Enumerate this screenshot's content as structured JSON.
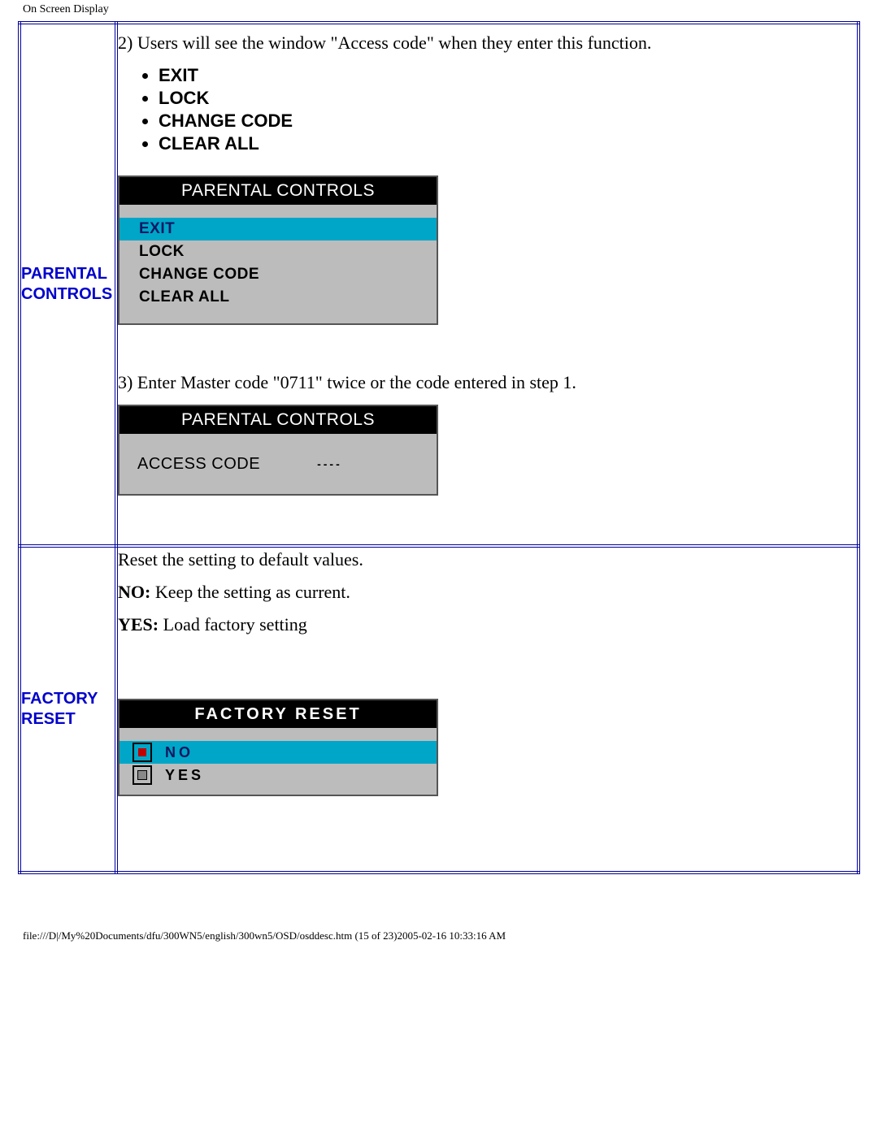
{
  "header": "On Screen Display",
  "rows": [
    {
      "label_line1": "PARENTAL",
      "label_line2": "CONTROLS",
      "step2_text": "2) Users will see the window \"Access code\" when they enter this function.",
      "bullets": [
        "EXIT",
        "LOCK",
        "CHANGE CODE",
        "CLEAR ALL"
      ],
      "osd1": {
        "title": "PARENTAL CONTROLS",
        "items": [
          {
            "label": "EXIT",
            "selected": true
          },
          {
            "label": "LOCK",
            "selected": false
          },
          {
            "label": "CHANGE CODE",
            "selected": false
          },
          {
            "label": "CLEAR ALL",
            "selected": false
          }
        ]
      },
      "step3_text": "3) Enter Master code \"0711\" twice or the code entered in step 1.",
      "osd2": {
        "title": "PARENTAL CONTROLS",
        "access_label": "ACCESS CODE",
        "access_value": "----"
      }
    },
    {
      "label_line1": "FACTORY",
      "label_line2": "RESET",
      "intro": "Reset the setting to default values.",
      "no_label": "NO:",
      "no_text": " Keep the setting as current.",
      "yes_label": "YES:",
      "yes_text": " Load factory setting",
      "osd": {
        "title": "FACTORY RESET",
        "items": [
          {
            "label": "NO",
            "selected": true,
            "checkbox": "red"
          },
          {
            "label": "YES",
            "selected": false,
            "checkbox": "grey"
          }
        ]
      }
    }
  ],
  "footer": "file:///D|/My%20Documents/dfu/300WN5/english/300wn5/OSD/osddesc.htm (15 of 23)2005-02-16 10:33:16 AM"
}
